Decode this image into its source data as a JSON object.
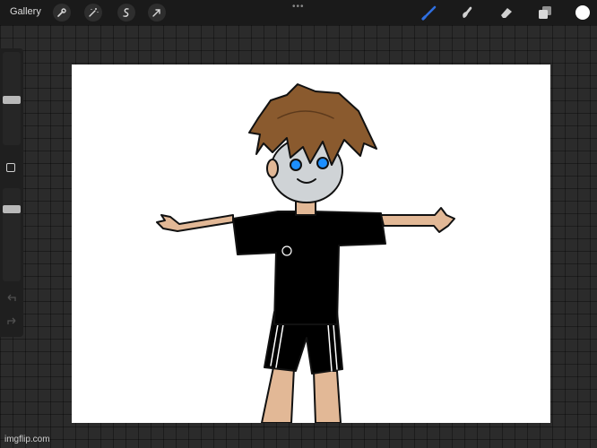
{
  "toolbar": {
    "gallery_label": "Gallery",
    "left_tools": [
      "wrench-icon",
      "magic-wand-icon",
      "selection-icon",
      "transform-arrow-icon"
    ],
    "more_label": "•••",
    "right_tools": [
      "brush-icon",
      "smudge-icon",
      "eraser-icon",
      "layers-icon"
    ],
    "active_tool": "brush-icon",
    "accent_color": "#2f6fe0",
    "current_color": "#ffffff"
  },
  "sidebar": {
    "brush_size_level": 0.2,
    "opacity_level": 0.8,
    "controls": [
      "modify-square-icon",
      "undo-icon",
      "redo-icon"
    ]
  },
  "watermark": "imgflip.com"
}
